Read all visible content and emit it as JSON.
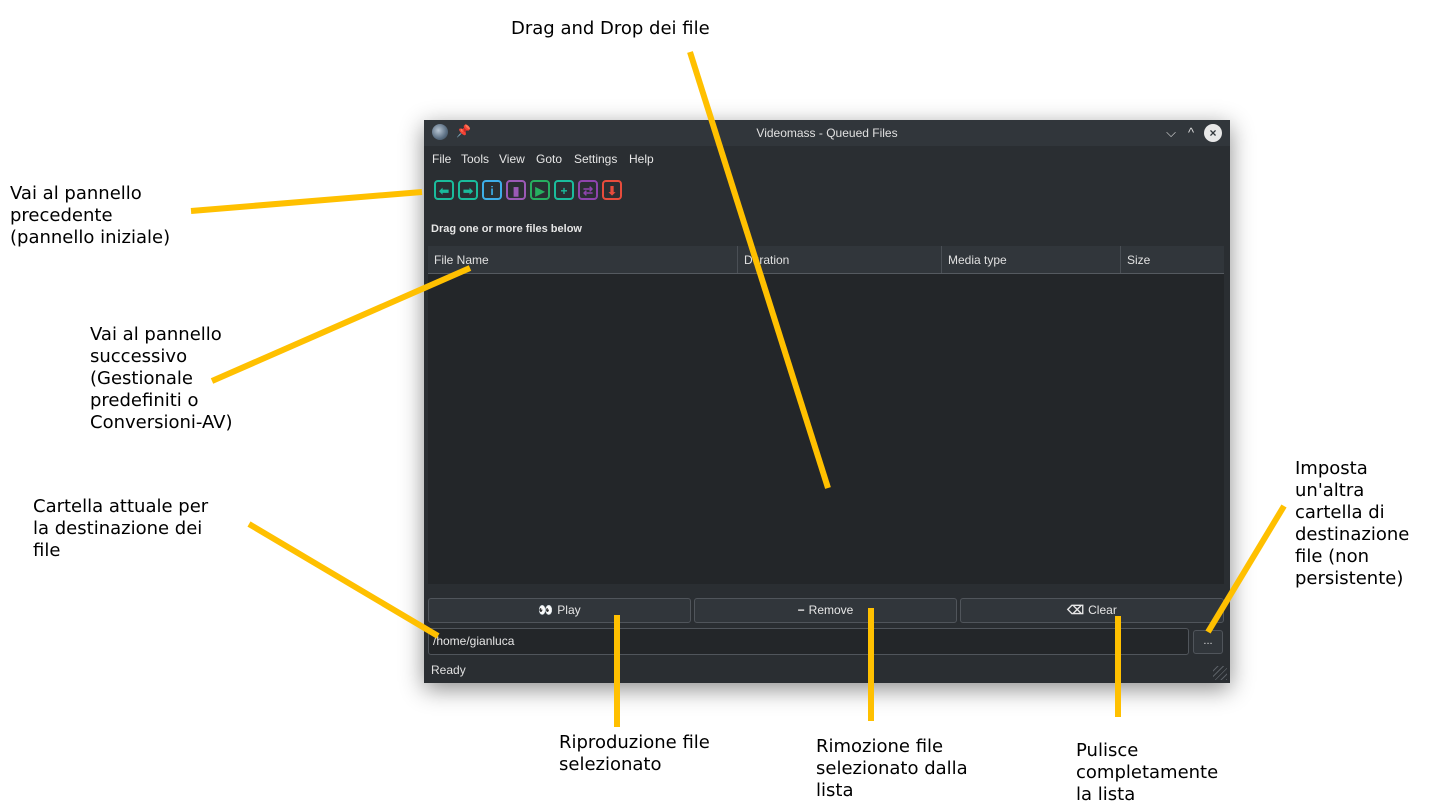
{
  "window": {
    "title": "Videomass - Queued Files",
    "controls": {
      "minimize": "⌵",
      "maximize": "^",
      "close": "×"
    }
  },
  "menu": [
    "File",
    "Tools",
    "View",
    "Goto",
    "Settings",
    "Help"
  ],
  "toolbar": {
    "buttons": [
      {
        "name": "back-icon",
        "glyph": "⬅",
        "color": "#1abc9c"
      },
      {
        "name": "forward-icon",
        "glyph": "➡",
        "color": "#1abc9c"
      },
      {
        "name": "media-info-icon",
        "glyph": "i",
        "color": "#3daee9"
      },
      {
        "name": "bar-chart-icon",
        "glyph": "▮",
        "color": "#9b59b6"
      },
      {
        "name": "play-icon",
        "glyph": "▶",
        "color": "#27ae60"
      },
      {
        "name": "add-list-icon",
        "glyph": "+",
        "color": "#1abc9c"
      },
      {
        "name": "swap-icon",
        "glyph": "⇄",
        "color": "#8e44ad"
      },
      {
        "name": "download-icon",
        "glyph": "⬇",
        "color": "#e74c3c"
      }
    ]
  },
  "drop_label": "Drag one or more files below",
  "columns": [
    "File Name",
    "Duration",
    "Media type",
    "Size"
  ],
  "buttons": {
    "play": "Play",
    "remove": "Remove",
    "clear": "Clear",
    "browse": "..."
  },
  "destination_path": "/home/gianluca",
  "status": "Ready",
  "annotations": {
    "drag_drop": "Drag and Drop dei file",
    "prev_panel": "Vai al pannello\nprecedente\n(pannello iniziale)",
    "next_panel": "Vai al pannello\nsuccessivo\n(Gestionale\npredefiniti o\nConversioni-AV)",
    "dest_folder": "Cartella attuale per\nla destinazione dei\nfile",
    "set_folder": "Imposta\nun'altra\ncartella di\ndestinazione\nfile (non\npersistente)",
    "play": "Riproduzione file\nselezionato",
    "remove": "Rimozione file\nselezionato dalla\nlista",
    "clear": "Pulisce\ncompletamente\nla lista"
  },
  "colors": {
    "arrow": "#ffc000",
    "window_bg": "#2a2e32",
    "titlebar": "#31363b",
    "list_bg": "#232629"
  }
}
